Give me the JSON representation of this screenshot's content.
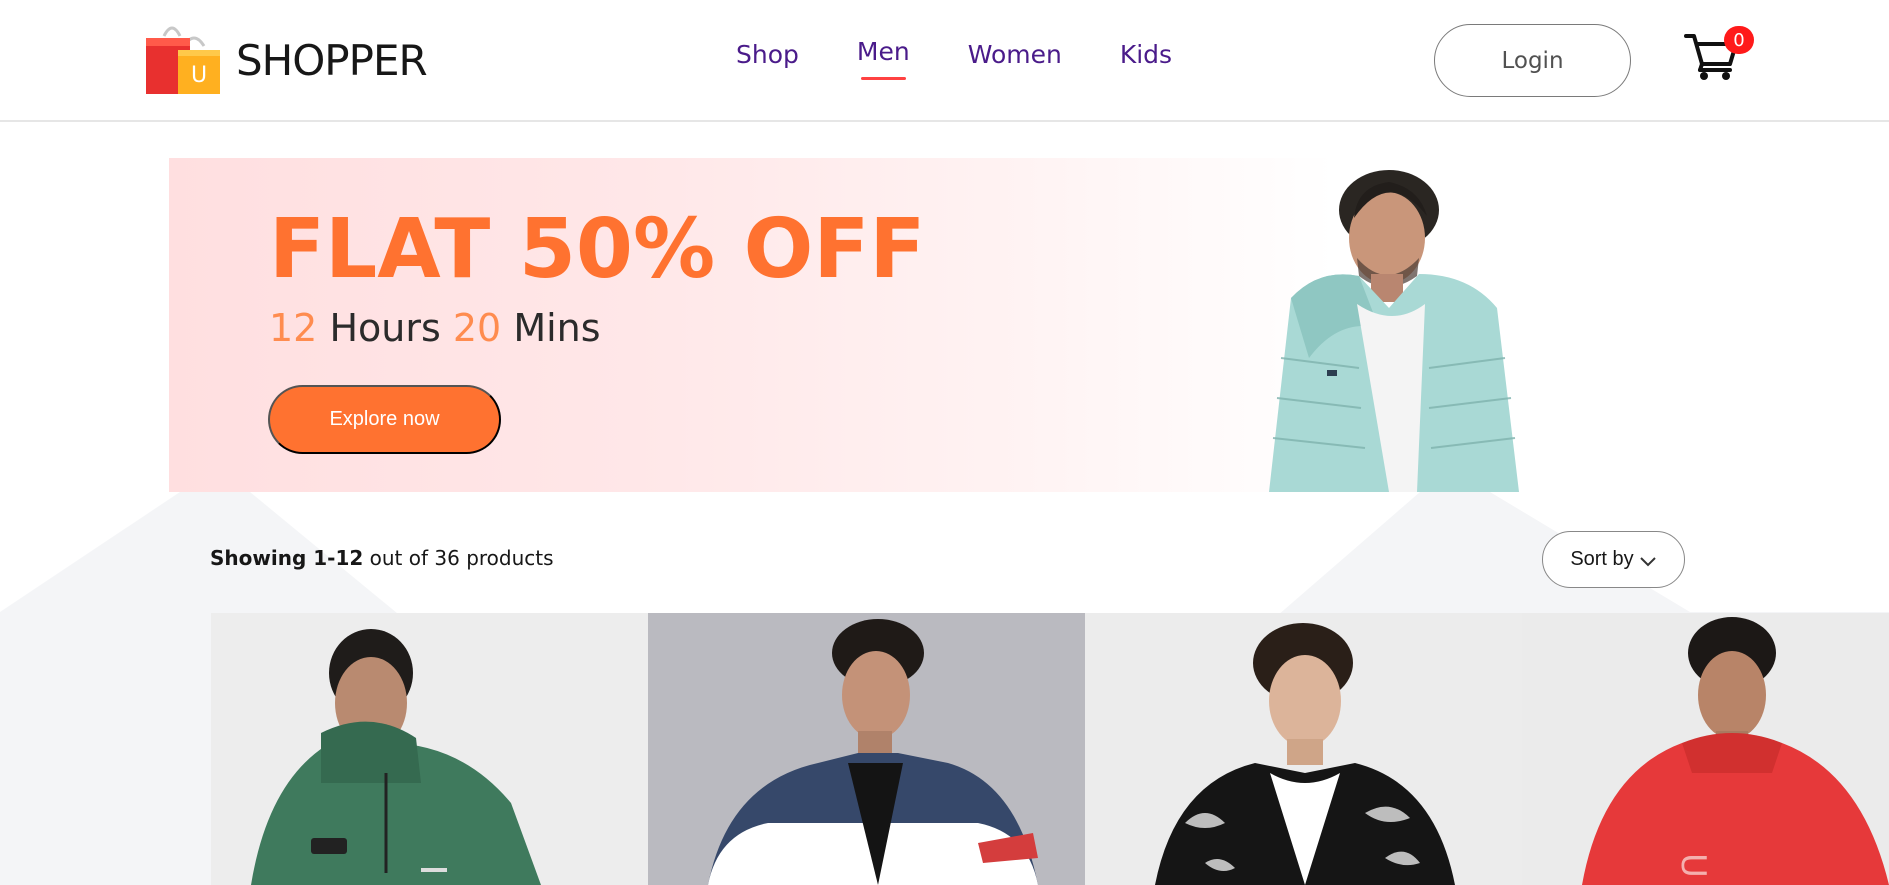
{
  "brand": {
    "name": "SHOPPER",
    "logo_icon": "shopping-bag-icon",
    "logo_letter": "U"
  },
  "nav": {
    "items": [
      {
        "label": "Shop",
        "active": false
      },
      {
        "label": "Men",
        "active": true
      },
      {
        "label": "Women",
        "active": false
      },
      {
        "label": "Kids",
        "active": false
      }
    ]
  },
  "header": {
    "login_label": "Login",
    "cart_icon": "cart-icon",
    "cart_count": "0"
  },
  "hero": {
    "title": "FLAT 50% OFF",
    "timer": {
      "hours_value": "12",
      "hours_label": "Hours",
      "mins_value": "20",
      "mins_label": "Mins"
    },
    "cta_label": "Explore now"
  },
  "products_bar": {
    "showing_bold": "Showing 1-12",
    "showing_rest": "out of 36 products",
    "sort_label": "Sort by",
    "sort_icon": "chevron-down-icon"
  },
  "colors": {
    "accent": "#ff7230",
    "nav_text": "#4a1b8a",
    "nav_underline": "#ff4141",
    "badge": "#ff1a1a"
  }
}
